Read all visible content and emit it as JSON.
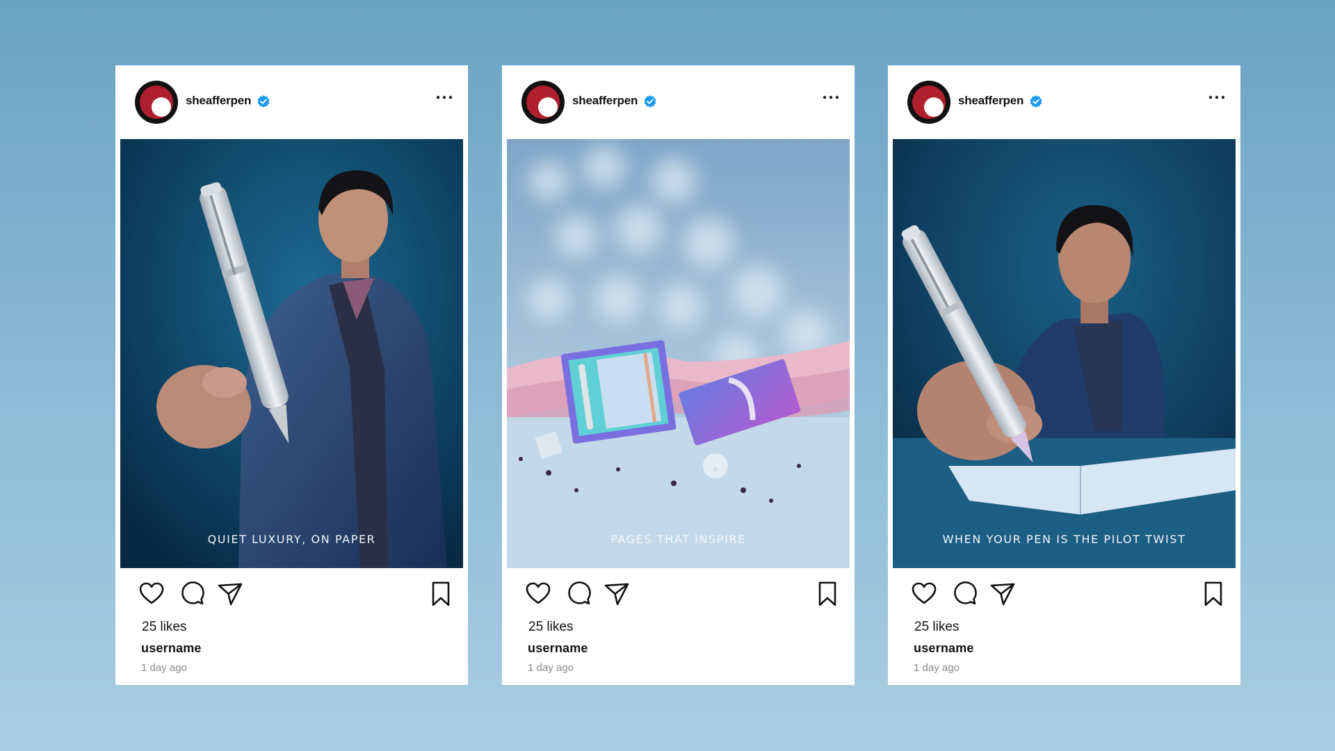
{
  "colors": {
    "background_top": "#6aa3c2",
    "background_bottom": "#a9cde3",
    "verified_badge": "#1d9bf0",
    "logo_red": "#b01f2e"
  },
  "posts": [
    {
      "account": "sheafferpen",
      "verified_icon": "verified-badge-icon",
      "more_icon": "more-options-icon",
      "caption": "QUIET LUXURY, ON PAPER",
      "likes": "25 likes",
      "username": "username",
      "time": "1 day ago"
    },
    {
      "account": "sheafferpen",
      "verified_icon": "verified-badge-icon",
      "more_icon": "more-options-icon",
      "caption": "PAGES THAT INSPIRE",
      "likes": "25 likes",
      "username": "username",
      "time": "1 day ago"
    },
    {
      "account": "sheafferpen",
      "verified_icon": "verified-badge-icon",
      "more_icon": "more-options-icon",
      "caption": "WHEN YOUR PEN IS THE PILOT TWIST",
      "likes": "25 likes",
      "username": "username",
      "time": "1 day ago"
    }
  ],
  "action_icons": [
    "heart-icon",
    "comment-icon",
    "share-icon",
    "bookmark-icon"
  ]
}
